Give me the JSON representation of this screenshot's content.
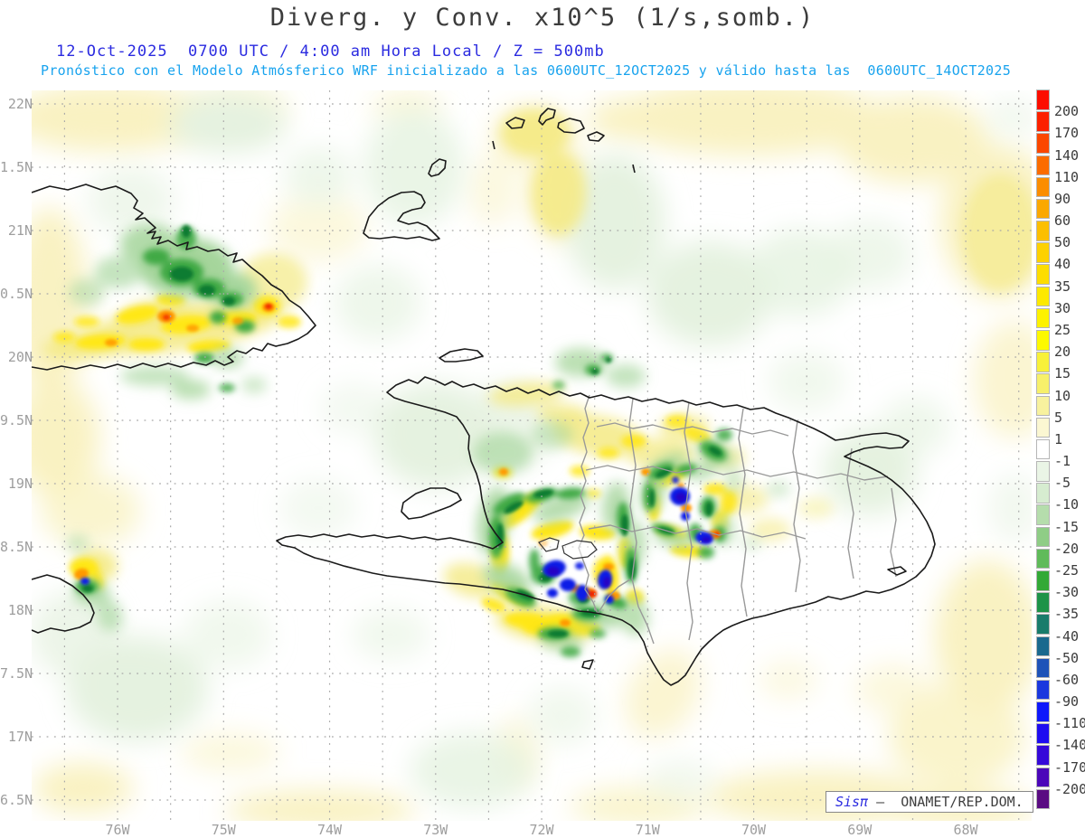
{
  "header": {
    "title": "Diverg. y Conv. x10^5 (1/s,somb.)",
    "subtitle_datetime": "12-Oct-2025  0700 UTC / 4:00 am Hora Local / Z = 500mb",
    "subtitle_model": "Pronóstico con el Modelo Atmósferico WRF inicializado a las 0600UTC_12OCT2025 y válido hasta las  0600UTC_14OCT2025"
  },
  "map": {
    "lat_labels": [
      "22N",
      "1.5N",
      "21N",
      "0.5N",
      "20N",
      "9.5N",
      "19N",
      "8.5N",
      "18N",
      "7.5N",
      "17N",
      "6.5N"
    ],
    "lon_labels": [
      "76W",
      "75W",
      "74W",
      "73W",
      "72W",
      "71W",
      "70W",
      "69W",
      "68W"
    ]
  },
  "colorbar": {
    "tick_labels": [
      "200",
      "170",
      "140",
      "110",
      "90",
      "60",
      "50",
      "40",
      "35",
      "30",
      "25",
      "20",
      "15",
      "10",
      "5",
      "1",
      "-1",
      "-5",
      "-10",
      "-15",
      "-20",
      "-25",
      "-30",
      "-35",
      "-40",
      "-50",
      "-60",
      "-90",
      "-110",
      "-140",
      "-170",
      "-200"
    ],
    "segment_colors": [
      "#fc0d00",
      "#fc2100",
      "#fb4700",
      "#fb6c00",
      "#fb8d00",
      "#fba800",
      "#fcbf00",
      "#fdd100",
      "#fddd00",
      "#fde900",
      "#fdf200",
      "#fdf900",
      "#f8f13a",
      "#f7f06a",
      "#f8f29e",
      "#fbf7d2",
      "#ffffff",
      "#eaf5e6",
      "#d6ecd0",
      "#b5ddac",
      "#8fcd86",
      "#60bb5a",
      "#33a936",
      "#1d9348",
      "#197c6b",
      "#1a698e",
      "#1e53b8",
      "#1b38de",
      "#0e18fb",
      "#1e0cf1",
      "#3509d9",
      "#4b07b9",
      "#5a0b82"
    ]
  },
  "credit": {
    "brand": "Sisπ",
    "dash": "–",
    "org": "ONAMET/REP.DOM."
  },
  "colors": {
    "title": "#3c3c3c",
    "subtitle_datetime": "#2b2be0",
    "subtitle_model": "#18a3ee",
    "axis_label": "#9e9e9e",
    "gridline": "#a8a8a8",
    "coastline": "#1a1a1a",
    "province_border": "#999999"
  }
}
